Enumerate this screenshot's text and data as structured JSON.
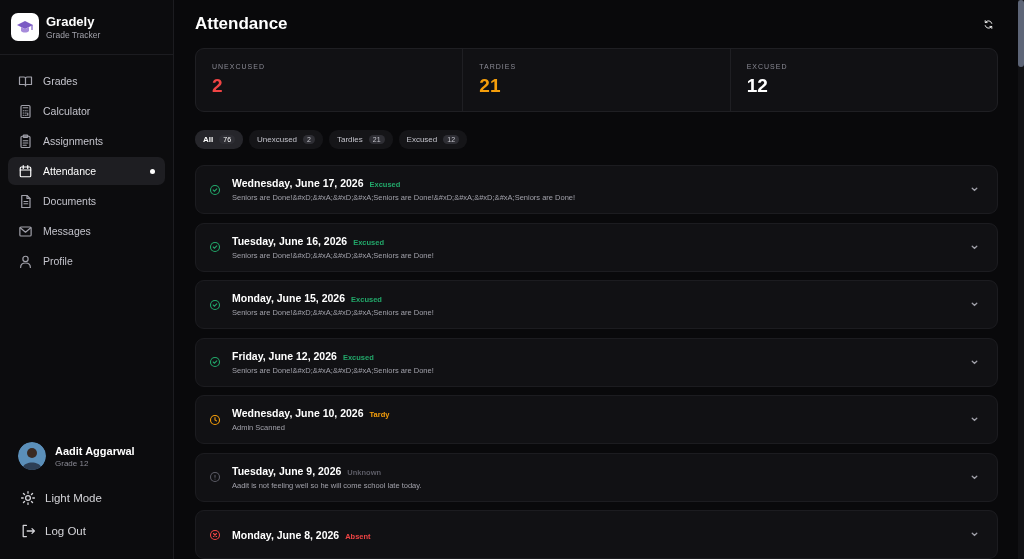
{
  "app": {
    "name": "Gradely",
    "subtitle": "Grade Tracker"
  },
  "nav": [
    {
      "label": "Grades",
      "kind": "book",
      "selected": false
    },
    {
      "label": "Calculator",
      "kind": "calculator",
      "selected": false
    },
    {
      "label": "Assignments",
      "kind": "clipboard",
      "selected": false
    },
    {
      "label": "Attendance",
      "kind": "calendar",
      "selected": true
    },
    {
      "label": "Documents",
      "kind": "document",
      "selected": false
    },
    {
      "label": "Messages",
      "kind": "mail",
      "selected": false
    },
    {
      "label": "Profile",
      "kind": "user",
      "selected": false
    }
  ],
  "user": {
    "name": "Aadit Aggarwal",
    "grade": "Grade 12"
  },
  "footer_actions": [
    {
      "label": "Light Mode",
      "kind": "sun"
    },
    {
      "label": "Log Out",
      "kind": "logout"
    }
  ],
  "page": {
    "title": "Attendance"
  },
  "stats": [
    {
      "label": "UNEXCUSED",
      "value": "2",
      "color": "#ef4444"
    },
    {
      "label": "TARDIES",
      "value": "21",
      "color": "#f59e0b"
    },
    {
      "label": "EXCUSED",
      "value": "12",
      "color": "#ffffff"
    }
  ],
  "filters": [
    {
      "label": "All",
      "count": "76",
      "selected": true
    },
    {
      "label": "Unexcused",
      "count": "2",
      "selected": false
    },
    {
      "label": "Tardies",
      "count": "21",
      "selected": false
    },
    {
      "label": "Excused",
      "count": "12",
      "selected": false
    }
  ],
  "entries": [
    {
      "date": "Wednesday, June 17, 2026",
      "status": "Excused",
      "kind": "excused",
      "note": "Seniors are Done!&#xD;&#xA;&#xD;&#xA;Seniors are Done!&#xD;&#xA;&#xD;&#xA;Seniors are Done!"
    },
    {
      "date": "Tuesday, June 16, 2026",
      "status": "Excused",
      "kind": "excused",
      "note": "Seniors are Done!&#xD;&#xA;&#xD;&#xA;Seniors are Done!"
    },
    {
      "date": "Monday, June 15, 2026",
      "status": "Excused",
      "kind": "excused",
      "note": "Seniors are Done!&#xD;&#xA;&#xD;&#xA;Seniors are Done!"
    },
    {
      "date": "Friday, June 12, 2026",
      "status": "Excused",
      "kind": "excused",
      "note": "Seniors are Done!&#xD;&#xA;&#xD;&#xA;Seniors are Done!"
    },
    {
      "date": "Wednesday, June 10, 2026",
      "status": "Tardy",
      "kind": "tardy",
      "note": "Admin Scanned"
    },
    {
      "date": "Tuesday, June 9, 2026",
      "status": "Unknown",
      "kind": "unknown",
      "note": "Aadit is not feeling well so he will come school late today."
    },
    {
      "date": "Monday, June 8, 2026",
      "status": "Absent",
      "kind": "absent"
    }
  ]
}
